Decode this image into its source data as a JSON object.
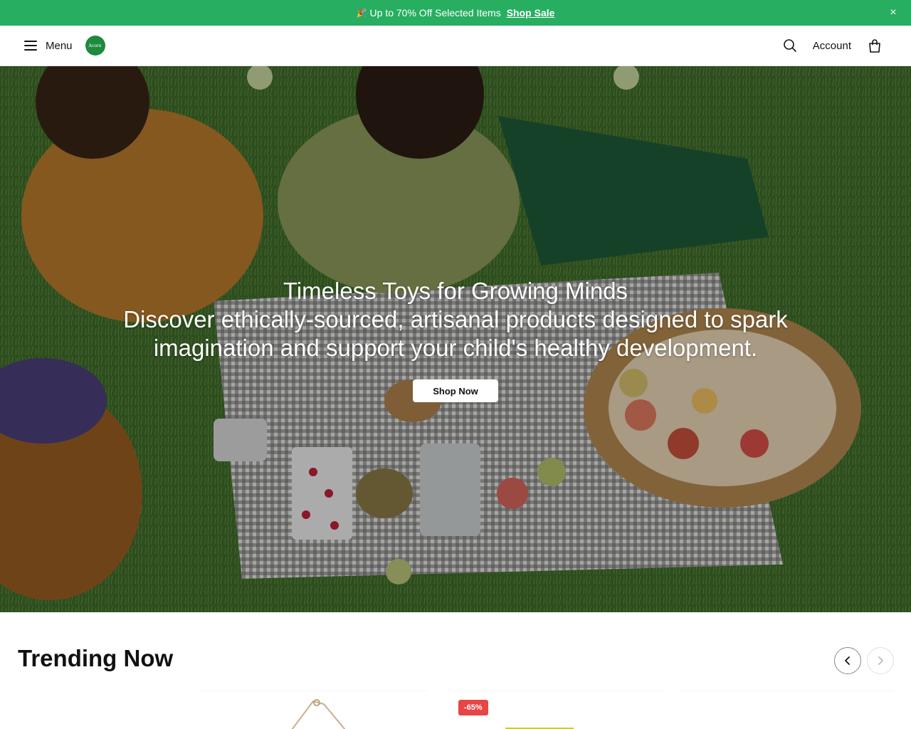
{
  "announcement": {
    "emoji": "🎉",
    "text": "Up to 70% Off Selected Items",
    "link_label": "Shop Sale",
    "close_glyph": "×"
  },
  "header": {
    "menu_label": "Menu",
    "logo_text": "Acorn",
    "account_label": "Account",
    "icons": [
      "hamburger-icon",
      "search-icon",
      "bag-icon"
    ]
  },
  "hero": {
    "title": "Timeless Toys for Growing Minds",
    "subtitle": "Discover ethically-sourced, artisanal products designed to spark imagination and support your child's healthy development.",
    "cta_label": "Shop Now"
  },
  "trending": {
    "title": "Trending Now",
    "prev_glyph": "‹",
    "next_glyph": "›",
    "badge": "-65%"
  },
  "colors": {
    "announcement_bg": "#27ae60",
    "logo_bg": "#1e8a3c",
    "badge_bg": "#e84545"
  }
}
